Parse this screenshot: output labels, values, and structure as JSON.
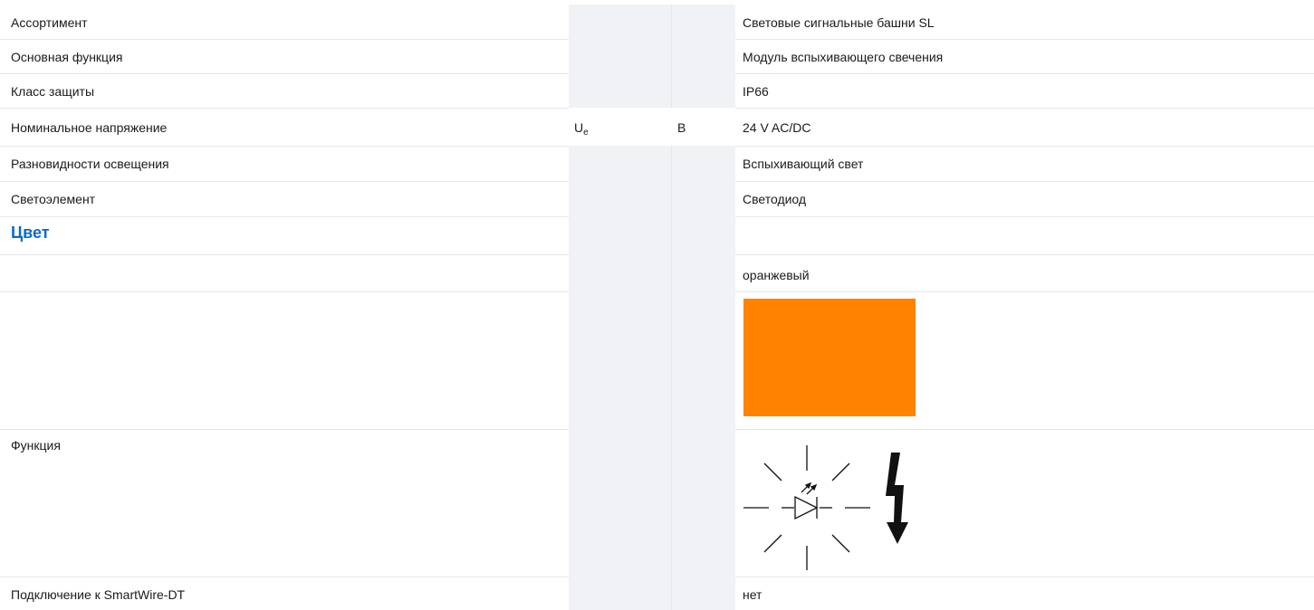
{
  "rows": [
    {
      "label": "Ассортимент",
      "symbol": "",
      "unit": "",
      "value": "Световые сигнальные башни SL"
    },
    {
      "label": "Основная функция",
      "symbol": "",
      "unit": "",
      "value": "Модуль вспыхивающего свечения"
    },
    {
      "label": "Класс защиты",
      "symbol": "",
      "unit": "",
      "value": "IP66"
    },
    {
      "label": "Номинальное напряжение",
      "symbol_main": "U",
      "symbol_sub": "e",
      "unit": "В",
      "value": "24 V AC/DC"
    },
    {
      "label": "Разновидности освещения",
      "symbol": "",
      "unit": "",
      "value": "Вспыхивающий свет"
    },
    {
      "label": "Светоэлемент",
      "symbol": "",
      "unit": "",
      "value": "Светодиод"
    },
    {
      "label": "Цвет",
      "symbol": "",
      "unit": "",
      "value": ""
    },
    {
      "label": "",
      "symbol": "",
      "unit": "",
      "value": "оранжевый"
    },
    {
      "label": "",
      "symbol": "",
      "unit": "",
      "value": ""
    },
    {
      "label": "Функция",
      "symbol": "",
      "unit": "",
      "value": ""
    },
    {
      "label": "Подключение к SmartWire-DT",
      "symbol": "",
      "unit": "",
      "value": "нет"
    }
  ],
  "colors": {
    "swatch": "#ff8200",
    "heading": "#0a6cc5",
    "column_shade": "#f0f2f6"
  },
  "icons": {
    "function": "flashing-led-icon",
    "flash": "lightning-arrow-icon"
  }
}
